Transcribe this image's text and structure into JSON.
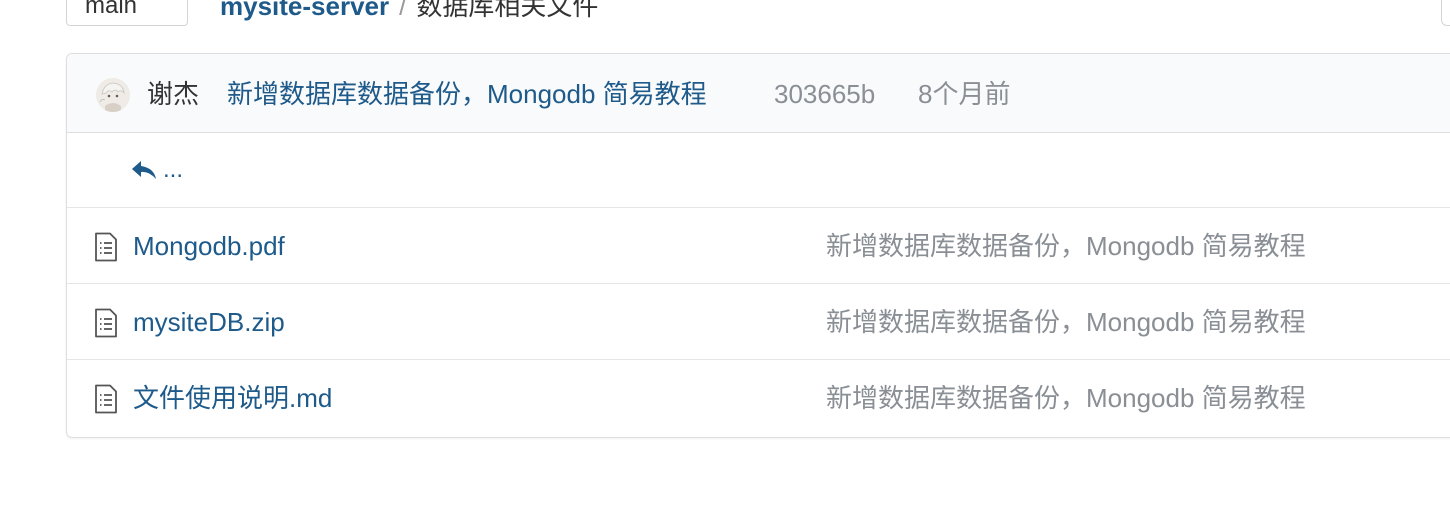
{
  "header": {
    "branch": "main",
    "repo": "mysite-server",
    "separator": "/",
    "folder": "数据库相关文件"
  },
  "commit": {
    "author": "谢杰",
    "message": "新增数据库数据备份，Mongodb 简易教程",
    "sha": "303665b",
    "time": "8个月前"
  },
  "parent_link": {
    "icon": "reply-arrow-icon",
    "label": "..."
  },
  "files": [
    {
      "icon": "file-text-icon",
      "name": "Mongodb.pdf",
      "commit": "新增数据库数据备份，Mongodb 简易教程"
    },
    {
      "icon": "file-text-icon",
      "name": "mysiteDB.zip",
      "commit": "新增数据库数据备份，Mongodb 简易教程"
    },
    {
      "icon": "file-text-icon",
      "name": "文件使用说明.md",
      "commit": "新增数据库数据备份，Mongodb 简易教程"
    }
  ],
  "colors": {
    "link": "#1e5a8a",
    "muted": "#8a8f95",
    "border": "#dedede",
    "header_bg": "#f9fafb"
  }
}
